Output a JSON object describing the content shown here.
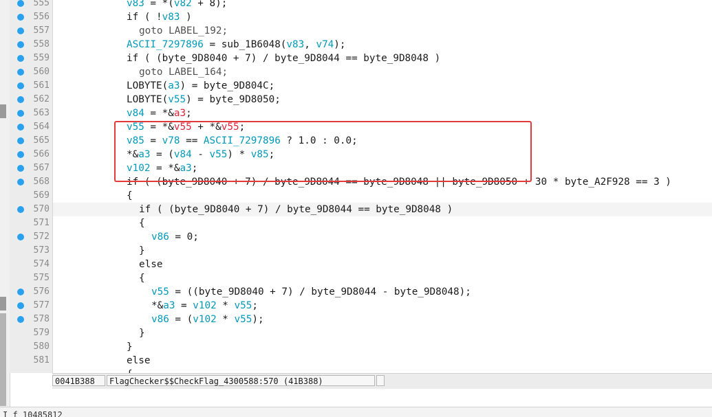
{
  "status_bar": {
    "address": "0041B388",
    "location": "FlagChecker$$CheckFlag_4300588:570 (41B388)"
  },
  "output": {
    "text": "I f 10485812"
  },
  "code_lines": [
    {
      "n": "555",
      "bp": true,
      "indent": 0,
      "tokens": [
        [
          "v83",
          "v"
        ],
        [
          " = *(",
          ""
        ],
        [
          "v82",
          "v"
        ],
        [
          " + 8);",
          ""
        ]
      ]
    },
    {
      "n": "556",
      "bp": true,
      "indent": 0,
      "tokens": [
        [
          "if ( !",
          ""
        ],
        [
          "v83",
          "v"
        ],
        [
          " )",
          ""
        ]
      ]
    },
    {
      "n": "557",
      "bp": true,
      "indent": 1,
      "tokens": [
        [
          "goto LABEL_192;",
          "l"
        ]
      ]
    },
    {
      "n": "558",
      "bp": true,
      "indent": 0,
      "tokens": [
        [
          "ASCII_7297896",
          "v"
        ],
        [
          " = sub_1B6048(",
          ""
        ],
        [
          "v83",
          "v"
        ],
        [
          ", ",
          ""
        ],
        [
          "v74",
          "v"
        ],
        [
          ");",
          ""
        ]
      ]
    },
    {
      "n": "559",
      "bp": true,
      "indent": 0,
      "tokens": [
        [
          "if ( (byte_9D8040 + 7) / byte_9D8044 == byte_9D8048 )",
          ""
        ]
      ]
    },
    {
      "n": "560",
      "bp": true,
      "indent": 1,
      "tokens": [
        [
          "goto LABEL_164;",
          "l"
        ]
      ]
    },
    {
      "n": "561",
      "bp": true,
      "indent": 0,
      "tokens": [
        [
          "LOBYTE(",
          ""
        ],
        [
          "a3",
          "v"
        ],
        [
          ") = byte_9D804C;",
          ""
        ]
      ]
    },
    {
      "n": "562",
      "bp": true,
      "indent": 0,
      "tokens": [
        [
          "LOBYTE(",
          ""
        ],
        [
          "v55",
          "v"
        ],
        [
          ") = byte_9D8050;",
          ""
        ]
      ]
    },
    {
      "n": "563",
      "bp": true,
      "indent": 0,
      "tokens": [
        [
          "v84",
          "v"
        ],
        [
          " = *&",
          ""
        ],
        [
          "a3",
          "h"
        ],
        [
          ";",
          ""
        ]
      ]
    },
    {
      "n": "564",
      "bp": true,
      "indent": 0,
      "tokens": [
        [
          "v55",
          "v"
        ],
        [
          " = *&",
          ""
        ],
        [
          "v55",
          "h"
        ],
        [
          " + *&",
          ""
        ],
        [
          "v55",
          "h"
        ],
        [
          ";",
          ""
        ]
      ]
    },
    {
      "n": "565",
      "bp": true,
      "indent": 0,
      "tokens": [
        [
          "v85",
          "v"
        ],
        [
          " = ",
          ""
        ],
        [
          "v78",
          "v"
        ],
        [
          " == ",
          ""
        ],
        [
          "ASCII_7297896",
          "v"
        ],
        [
          " ? 1.0 : 0.0;",
          ""
        ]
      ]
    },
    {
      "n": "566",
      "bp": true,
      "indent": 0,
      "tokens": [
        [
          "*&",
          ""
        ],
        [
          "a3",
          "v"
        ],
        [
          " = (",
          ""
        ],
        [
          "v84",
          "v"
        ],
        [
          " - ",
          ""
        ],
        [
          "v55",
          "v"
        ],
        [
          ") * ",
          ""
        ],
        [
          "v85",
          "v"
        ],
        [
          ";",
          ""
        ]
      ]
    },
    {
      "n": "567",
      "bp": true,
      "indent": 0,
      "tokens": [
        [
          "v102",
          "v"
        ],
        [
          " = *&",
          ""
        ],
        [
          "a3",
          "v"
        ],
        [
          ";",
          ""
        ]
      ]
    },
    {
      "n": "568",
      "bp": true,
      "indent": 0,
      "tokens": [
        [
          "if ( (byte_9D8040 + 7) / byte_9D8044 == byte_9D8048 || byte_9D8050 + 30 * byte_A2F928 == 3 )",
          ""
        ]
      ]
    },
    {
      "n": "569",
      "bp": false,
      "indent": 0,
      "tokens": [
        [
          "{",
          ""
        ]
      ]
    },
    {
      "n": "570",
      "bp": true,
      "indent": 1,
      "tokens": [
        [
          "if ( (byte_9D8040 + 7) / byte_9D8044 == byte_9D8048 )",
          ""
        ]
      ]
    },
    {
      "n": "571",
      "bp": false,
      "indent": 1,
      "tokens": [
        [
          "{",
          ""
        ]
      ]
    },
    {
      "n": "572",
      "bp": true,
      "indent": 2,
      "tokens": [
        [
          "v86",
          "v"
        ],
        [
          " = 0;",
          ""
        ]
      ]
    },
    {
      "n": "573",
      "bp": false,
      "indent": 1,
      "tokens": [
        [
          "}",
          ""
        ]
      ]
    },
    {
      "n": "574",
      "bp": false,
      "indent": 1,
      "tokens": [
        [
          "else",
          ""
        ]
      ]
    },
    {
      "n": "575",
      "bp": false,
      "indent": 1,
      "tokens": [
        [
          "{",
          ""
        ]
      ]
    },
    {
      "n": "576",
      "bp": true,
      "indent": 2,
      "tokens": [
        [
          "v55",
          "v"
        ],
        [
          " = ((byte_9D8040 + 7) / byte_9D8044 - byte_9D8048);",
          ""
        ]
      ]
    },
    {
      "n": "577",
      "bp": true,
      "indent": 2,
      "tokens": [
        [
          "*&",
          ""
        ],
        [
          "a3",
          "v"
        ],
        [
          " = ",
          ""
        ],
        [
          "v102",
          "v"
        ],
        [
          " * ",
          ""
        ],
        [
          "v55",
          "v"
        ],
        [
          ";",
          ""
        ]
      ]
    },
    {
      "n": "578",
      "bp": true,
      "indent": 2,
      "tokens": [
        [
          "v86",
          "v"
        ],
        [
          " = (",
          ""
        ],
        [
          "v102",
          "v"
        ],
        [
          " * ",
          ""
        ],
        [
          "v55",
          "v"
        ],
        [
          ");",
          ""
        ]
      ]
    },
    {
      "n": "579",
      "bp": false,
      "indent": 1,
      "tokens": [
        [
          "}",
          ""
        ]
      ]
    },
    {
      "n": "580",
      "bp": false,
      "indent": 0,
      "tokens": [
        [
          "}",
          ""
        ]
      ]
    },
    {
      "n": "581",
      "bp": false,
      "indent": 0,
      "tokens": [
        [
          "else",
          ""
        ]
      ]
    },
    {
      "n": "",
      "bp": false,
      "indent": 0,
      "tokens": [
        [
          "{",
          ""
        ]
      ]
    }
  ]
}
